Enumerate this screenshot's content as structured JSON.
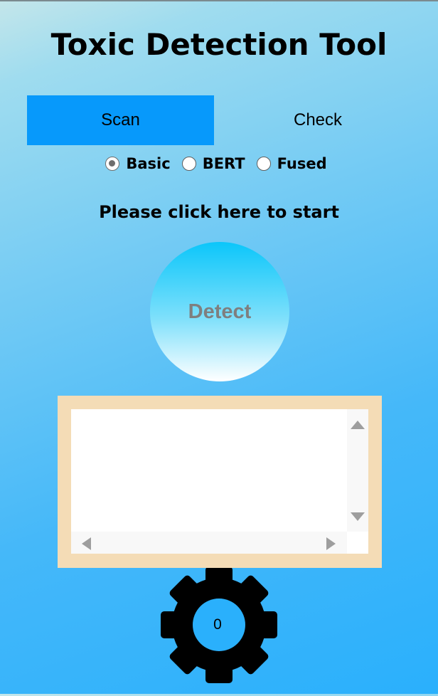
{
  "app": {
    "title": "Toxic Detection Tool"
  },
  "tabs": [
    {
      "label": "Scan",
      "active": true
    },
    {
      "label": "Check",
      "active": false
    }
  ],
  "model_options": [
    {
      "label": "Basic",
      "selected": true
    },
    {
      "label": "BERT",
      "selected": false
    },
    {
      "label": "Fused",
      "selected": false
    }
  ],
  "instruction": "Please click here to start",
  "detect_button": {
    "label": "Detect"
  },
  "output": {
    "value": ""
  },
  "settings": {
    "count": "0",
    "icon": "gear-icon"
  },
  "colors": {
    "active_tab": "#0799fb",
    "frame": "#f4dcb6",
    "detect_text": "#7f7f7f"
  }
}
